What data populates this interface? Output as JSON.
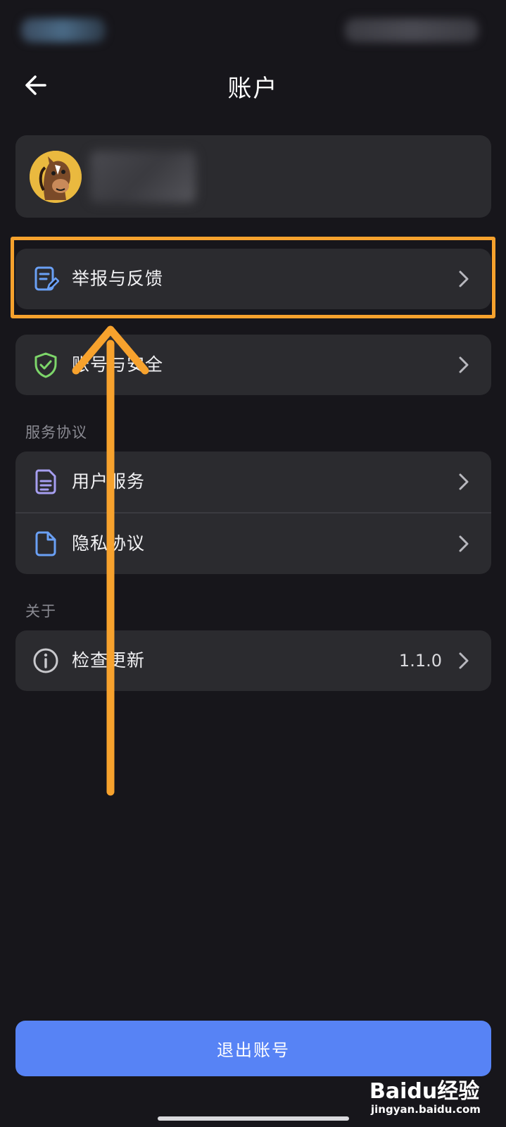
{
  "header": {
    "title": "账户"
  },
  "menu": {
    "report": {
      "label": "举报与反馈"
    },
    "security": {
      "label": "账号与安全"
    }
  },
  "sections": {
    "service": {
      "title": "服务协议",
      "items": [
        {
          "label": "用户服务"
        },
        {
          "label": "隐私协议"
        }
      ]
    },
    "about": {
      "title": "关于",
      "update": {
        "label": "检查更新",
        "version": "1.1.0"
      }
    }
  },
  "logout": {
    "label": "退出账号"
  },
  "watermark": {
    "logo": "Baidu经验",
    "url": "jingyan.baidu.com"
  },
  "colors": {
    "background": "#17161b",
    "card": "#2b2b2f",
    "accent": "#5783f5",
    "highlight": "#f7a22d",
    "shield": "#7dd66a",
    "doc_purple": "#a69ef0",
    "doc_blue": "#6aa0f5"
  },
  "icons": [
    "back-arrow-icon",
    "edit-document-icon",
    "shield-check-icon",
    "document-lines-icon",
    "document-icon",
    "info-icon",
    "chevron-right-icon"
  ]
}
